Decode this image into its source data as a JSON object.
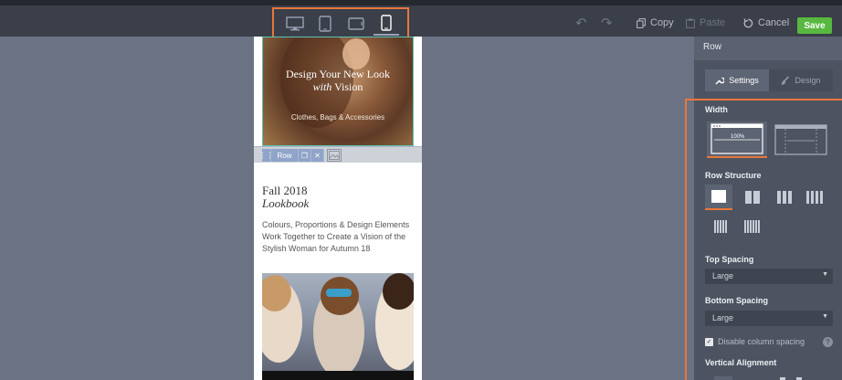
{
  "toolbar": {
    "devices": [
      "desktop-view",
      "tablet-portrait-view",
      "tablet-landscape-view",
      "mobile-view"
    ],
    "active_device": "mobile-view",
    "copy_label": "Copy",
    "paste_label": "Paste",
    "cancel_label": "Cancel",
    "save_label": "Save",
    "accent_color": "#e8773a",
    "save_color": "#58b83f"
  },
  "canvas": {
    "hero": {
      "title_line1": "Design Your New Look",
      "title_line2_italic": "with",
      "title_line2_rest": "Vision",
      "subtitle": "Clothes, Bags & Accessories"
    },
    "row_toolbar": {
      "label": "Row"
    },
    "lookbook": {
      "title": "Fall 2018",
      "subtitle": "Lookbook",
      "body": "Colours, Proportions & Design Elements Work Together to Create a Vision of the Stylish Woman for Autumn 18"
    }
  },
  "panel": {
    "header": "Row",
    "tabs": [
      {
        "label": "Settings",
        "icon": "wrench-icon",
        "active": true
      },
      {
        "label": "Design",
        "icon": "brush-icon",
        "active": false
      }
    ],
    "width": {
      "label": "Width",
      "full_label": "100%",
      "selected": "full"
    },
    "row_structure": {
      "label": "Row Structure",
      "options": [
        1,
        2,
        3,
        4,
        5,
        6
      ],
      "selected": 1
    },
    "top_spacing": {
      "label": "Top Spacing",
      "value": "Large"
    },
    "bottom_spacing": {
      "label": "Bottom Spacing",
      "value": "Large"
    },
    "disable_column_spacing": {
      "label": "Disable column spacing",
      "checked": true
    },
    "vertical_alignment": {
      "label": "Vertical Alignment"
    }
  }
}
